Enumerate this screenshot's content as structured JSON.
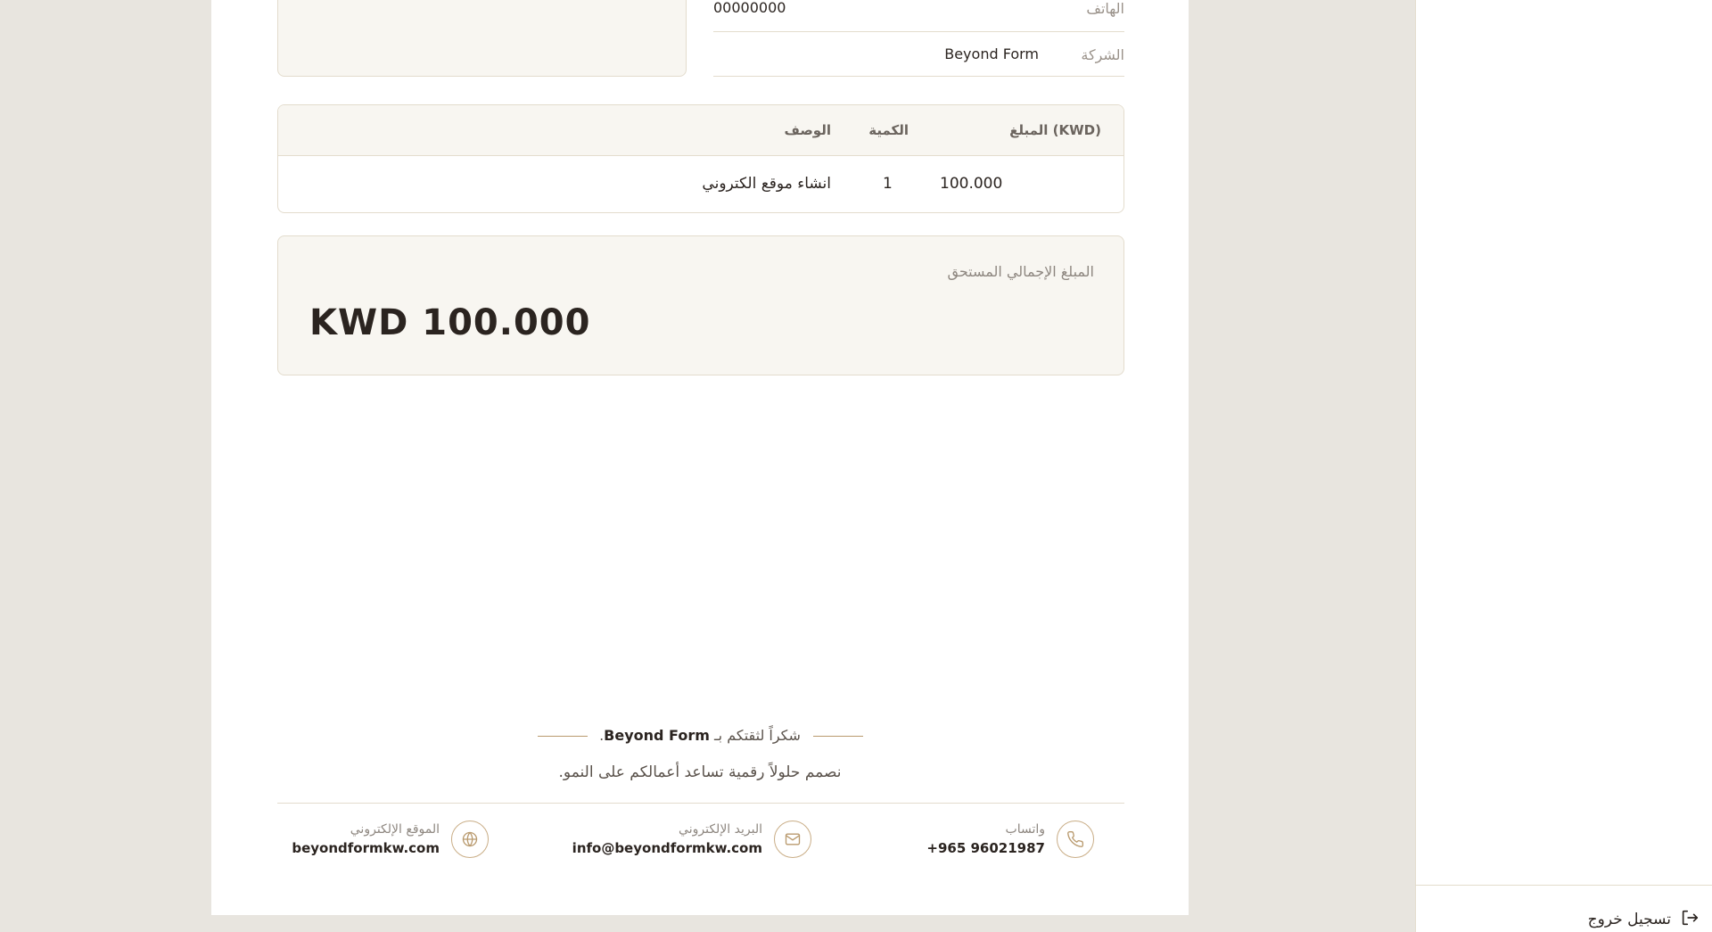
{
  "client": {
    "phone_label": "الهاتف",
    "phone_value": "00000000",
    "company_label": "الشركة",
    "company_value": "Beyond Form"
  },
  "items_table": {
    "headers": {
      "amount": "المبلغ (KWD)",
      "quantity": "الكمية",
      "description": "الوصف"
    },
    "rows": [
      {
        "amount": "100.000",
        "quantity": "1",
        "description": "انشاء موقع الكتروني"
      }
    ]
  },
  "total": {
    "label": "المبلغ الإجمالي المستحق",
    "amount": "KWD 100.000"
  },
  "footer": {
    "thanks_prefix": "شكراً لثقتكم بـ",
    "thanks_brand": "Beyond Form",
    "thanks_suffix": ".",
    "tagline": "نصمم حلولاً رقمية تساعد أعمالكم على النمو.",
    "contacts": [
      {
        "label": "واتساب",
        "value": "+965 96021987",
        "icon": "phone-icon"
      },
      {
        "label": "البريد الإلكتروني",
        "value": "info@beyondformkw.com",
        "icon": "mail-icon"
      },
      {
        "label": "الموقع الإلكتروني",
        "value": "beyondformkw.com",
        "icon": "globe-icon"
      }
    ]
  },
  "sidebar": {
    "logout_label": "تسجيل خروج",
    "logout_icon": "logout-icon"
  },
  "colors": {
    "accent": "#b99a6e",
    "panel": "#f8f6f1",
    "border": "#e3dccd",
    "canvas": "#e8e5df"
  }
}
